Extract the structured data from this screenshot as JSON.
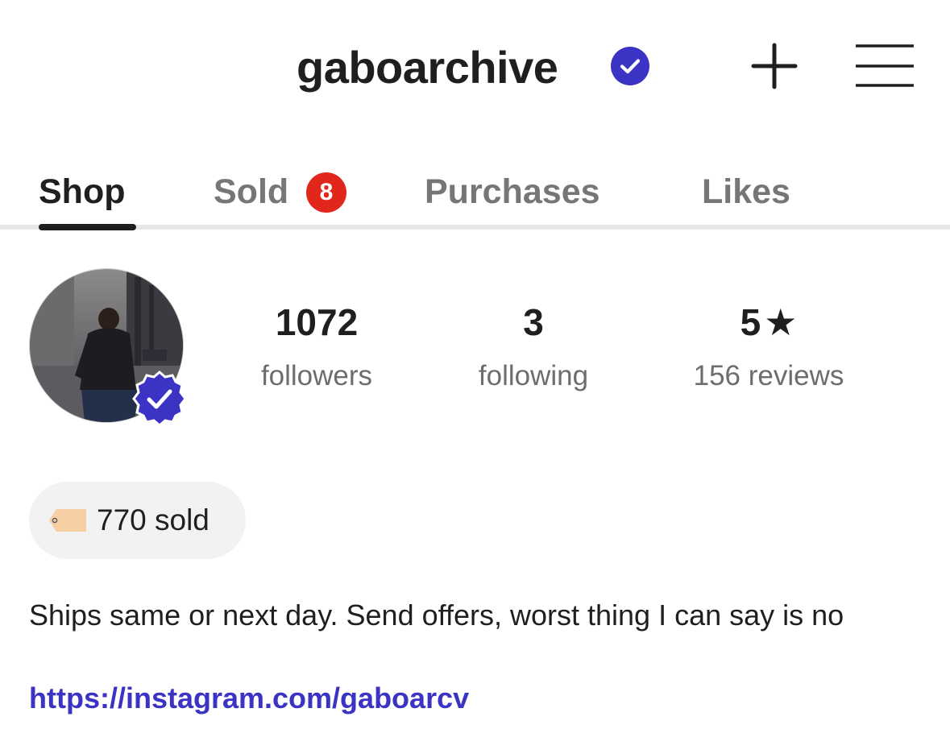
{
  "header": {
    "username": "gaboarchive",
    "verified_icon": "verified-check-icon",
    "accent_color": "#3b33c4"
  },
  "tabs": [
    {
      "label": "Shop",
      "active": true
    },
    {
      "label": "Sold",
      "badge": "8"
    },
    {
      "label": "Purchases"
    },
    {
      "label": "Likes"
    }
  ],
  "profile": {
    "stats": {
      "followers": {
        "value": "1072",
        "label": "followers"
      },
      "following": {
        "value": "3",
        "label": "following"
      },
      "rating": {
        "value": "5",
        "label": "156 reviews"
      }
    },
    "sold_count": "770 sold",
    "bio": "Ships same or next day. Send offers, worst thing I can say is no",
    "link": "https://instagram.com/gaboarcv"
  },
  "colors": {
    "badge_red": "#e1261c",
    "link_blue": "#3b33c4",
    "pill_bg": "#f2f2f2",
    "tag_color": "#f6cfa4"
  }
}
